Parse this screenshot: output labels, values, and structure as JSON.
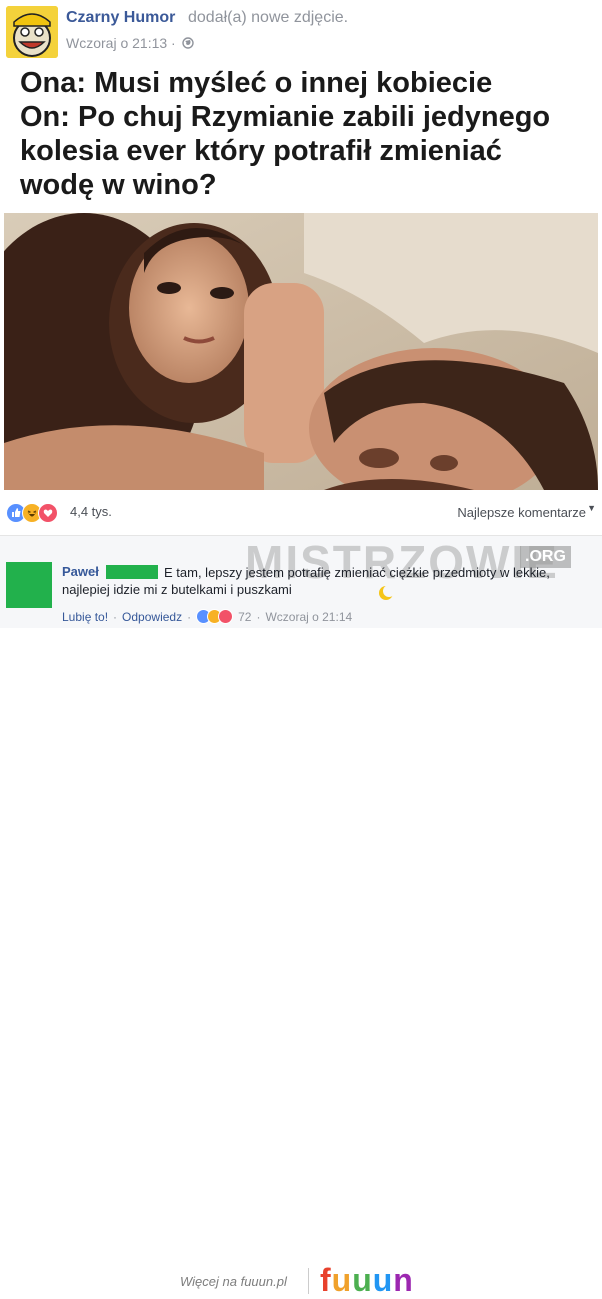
{
  "post": {
    "page_name": "Czarny Humor",
    "action": "dodał(a) nowe zdjęcie.",
    "time": "Wczoraj o 21:13 ·",
    "meme_lines": [
      "Ona: Musi myśleć o innej kobiecie",
      "On: Po chuj Rzymianie zabili jedynego",
      "kolesia ever który potrafił zmieniać",
      "wodę w wino?"
    ]
  },
  "reactions": {
    "count": "4,4 tys.",
    "best_comments": "Najlepsze komentarze",
    "icons": [
      "like-icon",
      "haha-icon",
      "love-icon"
    ]
  },
  "comment": {
    "author": "Paweł",
    "text": "E tam, lepszy jestem potrafię zmieniać ciężkie przedmioty w lekkie, najlepiej idzie mi z butelkami i puszkami",
    "like": "Lubię to!",
    "reply": "Odpowiedz",
    "reaction_count": "72",
    "time": "Wczoraj o 21:14"
  },
  "watermark": {
    "text": "MISTRZOWIE",
    "suffix": ".ORG"
  },
  "footer": {
    "more": "Więcej na fuuun.pl",
    "logo": [
      "f",
      "u",
      "u",
      "u",
      "n"
    ],
    "logo_colors": [
      "#e8412c",
      "#f0a12b",
      "#4caf50",
      "#2196f3",
      "#9c27b0"
    ]
  },
  "colors": {
    "link": "#3b5998",
    "meta": "#90949c",
    "avatar_green": "#22b14c"
  }
}
